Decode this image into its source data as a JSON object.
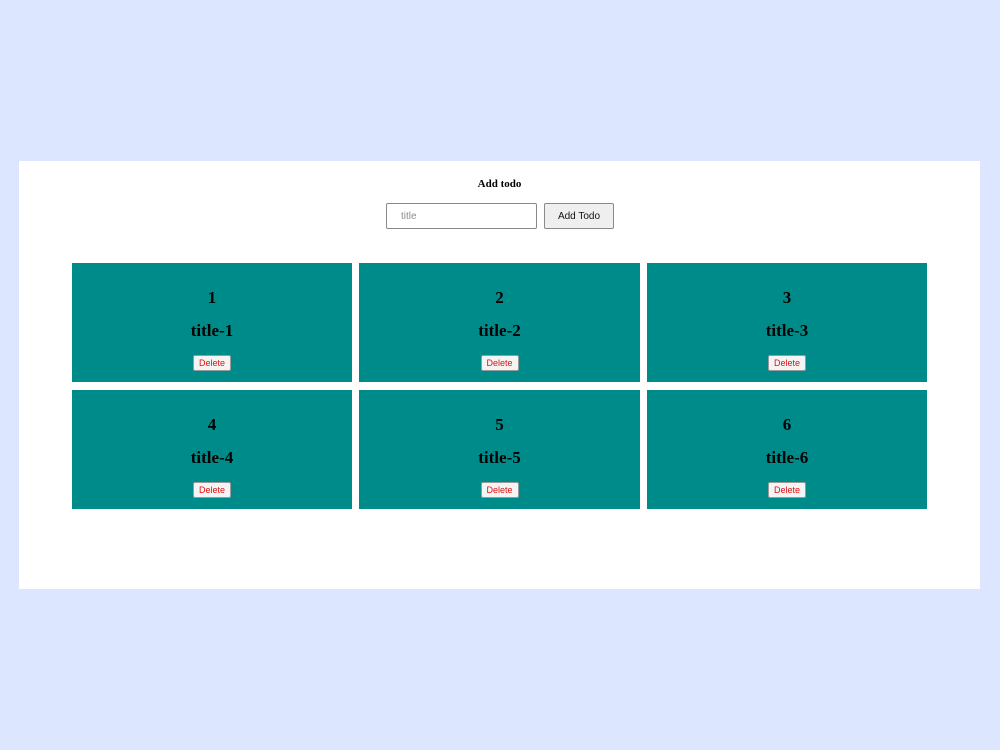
{
  "form": {
    "heading": "Add todo",
    "title_placeholder": "title",
    "title_value": "",
    "add_button_label": "Add Todo"
  },
  "todos": [
    {
      "id": "1",
      "title": "title-1",
      "delete_label": "Delete"
    },
    {
      "id": "2",
      "title": "title-2",
      "delete_label": "Delete"
    },
    {
      "id": "3",
      "title": "title-3",
      "delete_label": "Delete"
    },
    {
      "id": "4",
      "title": "title-4",
      "delete_label": "Delete"
    },
    {
      "id": "5",
      "title": "title-5",
      "delete_label": "Delete"
    },
    {
      "id": "6",
      "title": "title-6",
      "delete_label": "Delete"
    }
  ],
  "colors": {
    "page_background": "#dce6ff",
    "panel_background": "#ffffff",
    "card_background": "#008b8b",
    "delete_text": "#e01010"
  }
}
